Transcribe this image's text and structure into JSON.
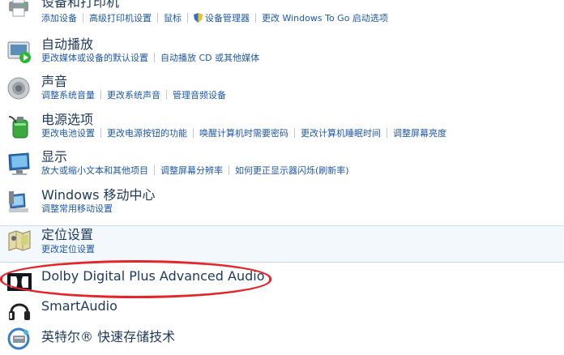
{
  "items": [
    {
      "title": "设备和打印机",
      "links": [
        "添加设备",
        "高级打印机设置",
        "鼠标",
        "设备管理器",
        "更改 Windows To Go 启动选项"
      ],
      "icon": "printer-icon"
    },
    {
      "title": "自动播放",
      "links": [
        "更改媒体或设备的默认设置",
        "自动播放 CD 或其他媒体"
      ],
      "icon": "autoplay-icon"
    },
    {
      "title": "声音",
      "links": [
        "调整系统音量",
        "更改系统声音",
        "管理音频设备"
      ],
      "icon": "speaker-icon"
    },
    {
      "title": "电源选项",
      "links": [
        "更改电池设置",
        "更改电源按钮的功能",
        "唤醒计算机时需要密码",
        "更改计算机睡眠时间",
        "调整屏幕亮度"
      ],
      "icon": "battery-icon"
    },
    {
      "title": "显示",
      "links": [
        "放大或缩小文本和其他项目",
        "调整屏幕分辨率",
        "如何更正显示器闪烁(刷新率)"
      ],
      "icon": "monitor-icon"
    },
    {
      "title": "Windows 移动中心",
      "links": [
        "调整常用移动设置"
      ],
      "icon": "mobility-center-icon"
    },
    {
      "title": "定位设置",
      "links": [
        "更改定位设置"
      ],
      "icon": "location-icon"
    },
    {
      "title": "Dolby Digital Plus Advanced Audio",
      "links": [],
      "icon": "dolby-icon"
    },
    {
      "title": "SmartAudio",
      "links": [],
      "icon": "headphones-icon"
    },
    {
      "title": "英特尔® 快速存储技术",
      "links": [],
      "icon": "intel-storage-icon"
    }
  ],
  "colors": {
    "title": "#1e395b",
    "link": "#1e57a8",
    "highlight": "#e4262b"
  }
}
